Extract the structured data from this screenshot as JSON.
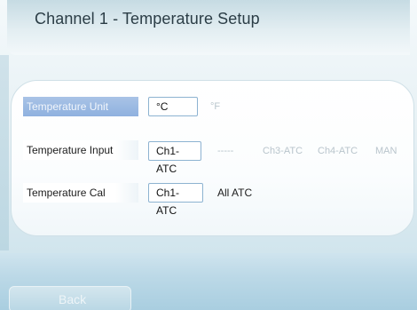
{
  "header": {
    "title": "Channel 1 - Temperature Setup"
  },
  "rows": {
    "unit": {
      "label": "Temperature Unit",
      "selected": "°C",
      "option_f": "°F"
    },
    "input": {
      "label": "Temperature Input",
      "selected": "Ch1-ATC",
      "dashes": "-----",
      "option_ch3": "Ch3-ATC",
      "option_ch4": "Ch4-ATC",
      "option_man": "MAN"
    },
    "cal": {
      "label": "Temperature  Cal",
      "selected": "Ch1-ATC",
      "option_all": "All ATC"
    }
  },
  "footer": {
    "back_label": "Back"
  },
  "colors": {
    "active_label": "#8fb1df",
    "box_border": "#8db3d1",
    "disabled_text": "#b9c5cc"
  }
}
